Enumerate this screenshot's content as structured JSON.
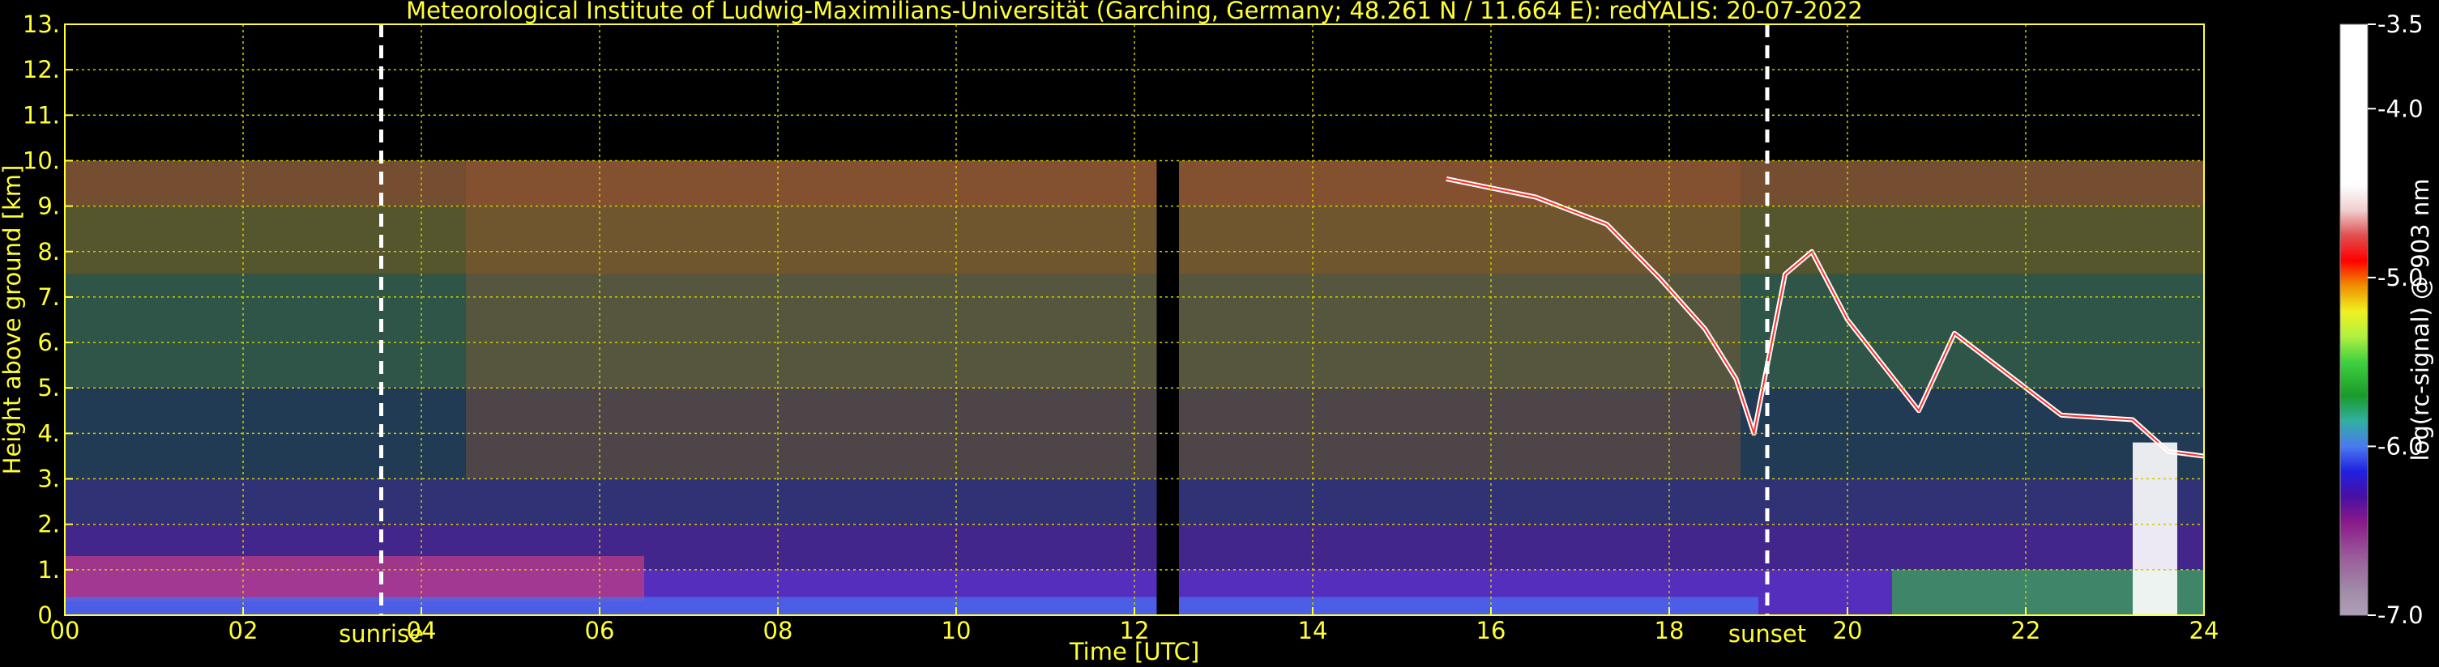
{
  "chart_data": {
    "type": "heatmap",
    "title": "Meteorological Institute of Ludwig-Maximilians-Universität (Garching, Germany; 48.261 N / 11.664 E):    redYALIS: 20-07-2022",
    "xlabel": "Time [UTC]",
    "ylabel": "Height above ground [km]",
    "x_unit": "hours UTC",
    "xlim": [
      0,
      24
    ],
    "ylim": [
      0,
      13
    ],
    "xticks": [
      0,
      2,
      4,
      6,
      8,
      10,
      12,
      14,
      16,
      18,
      20,
      22,
      24
    ],
    "xtick_labels": [
      "00",
      "02",
      "04",
      "06",
      "08",
      "10",
      "12",
      "14",
      "16",
      "18",
      "20",
      "22",
      "24"
    ],
    "yticks": [
      0,
      1,
      2,
      3,
      4,
      5,
      6,
      7,
      8,
      9,
      10,
      11,
      12,
      13
    ],
    "ytick_labels": [
      "0.",
      "1.",
      "2.",
      "3.",
      "4.",
      "5.",
      "6.",
      "7.",
      "8.",
      "9.",
      "10.",
      "11.",
      "12.",
      "13."
    ],
    "grid": true,
    "data_top_km": 10,
    "no_data_gap_hours": [
      12.25,
      12.5
    ],
    "markers": [
      {
        "label": "sunrise",
        "time": 3.55
      },
      {
        "label": "sunset",
        "time": 19.1
      }
    ],
    "colorbar": {
      "label": "log(rc-signal) @ 903 nm",
      "range": [
        -7.0,
        -3.5
      ],
      "ticks": [
        -3.5,
        -4.0,
        -5.0,
        -6.0,
        -7.0
      ],
      "tick_labels": [
        "-3.5",
        "-4.0",
        "-5.0",
        "-6.0",
        "-7.0"
      ],
      "stops": [
        {
          "v": -7.0,
          "c": "#b0a0b8"
        },
        {
          "v": -6.85,
          "c": "#a08aa8"
        },
        {
          "v": -6.65,
          "c": "#9a5a9a"
        },
        {
          "v": -6.45,
          "c": "#8a1a8a"
        },
        {
          "v": -6.3,
          "c": "#4a10a0"
        },
        {
          "v": -6.15,
          "c": "#2020e0"
        },
        {
          "v": -6.0,
          "c": "#4a7af0"
        },
        {
          "v": -5.85,
          "c": "#30b0a0"
        },
        {
          "v": -5.7,
          "c": "#1a9a2a"
        },
        {
          "v": -5.5,
          "c": "#40d040"
        },
        {
          "v": -5.35,
          "c": "#b0f040"
        },
        {
          "v": -5.2,
          "c": "#f0f020"
        },
        {
          "v": -5.05,
          "c": "#f09000"
        },
        {
          "v": -4.9,
          "c": "#ff0000"
        },
        {
          "v": -4.75,
          "c": "#e05050"
        },
        {
          "v": -4.6,
          "c": "#f0d0d0"
        },
        {
          "v": -4.45,
          "c": "#ffffff"
        },
        {
          "v": -3.5,
          "c": "#ffffff"
        }
      ]
    }
  },
  "colors": {
    "background": "#000000",
    "text": "#ffff33",
    "grid": "#cccc00",
    "marker": "#ffffff"
  }
}
